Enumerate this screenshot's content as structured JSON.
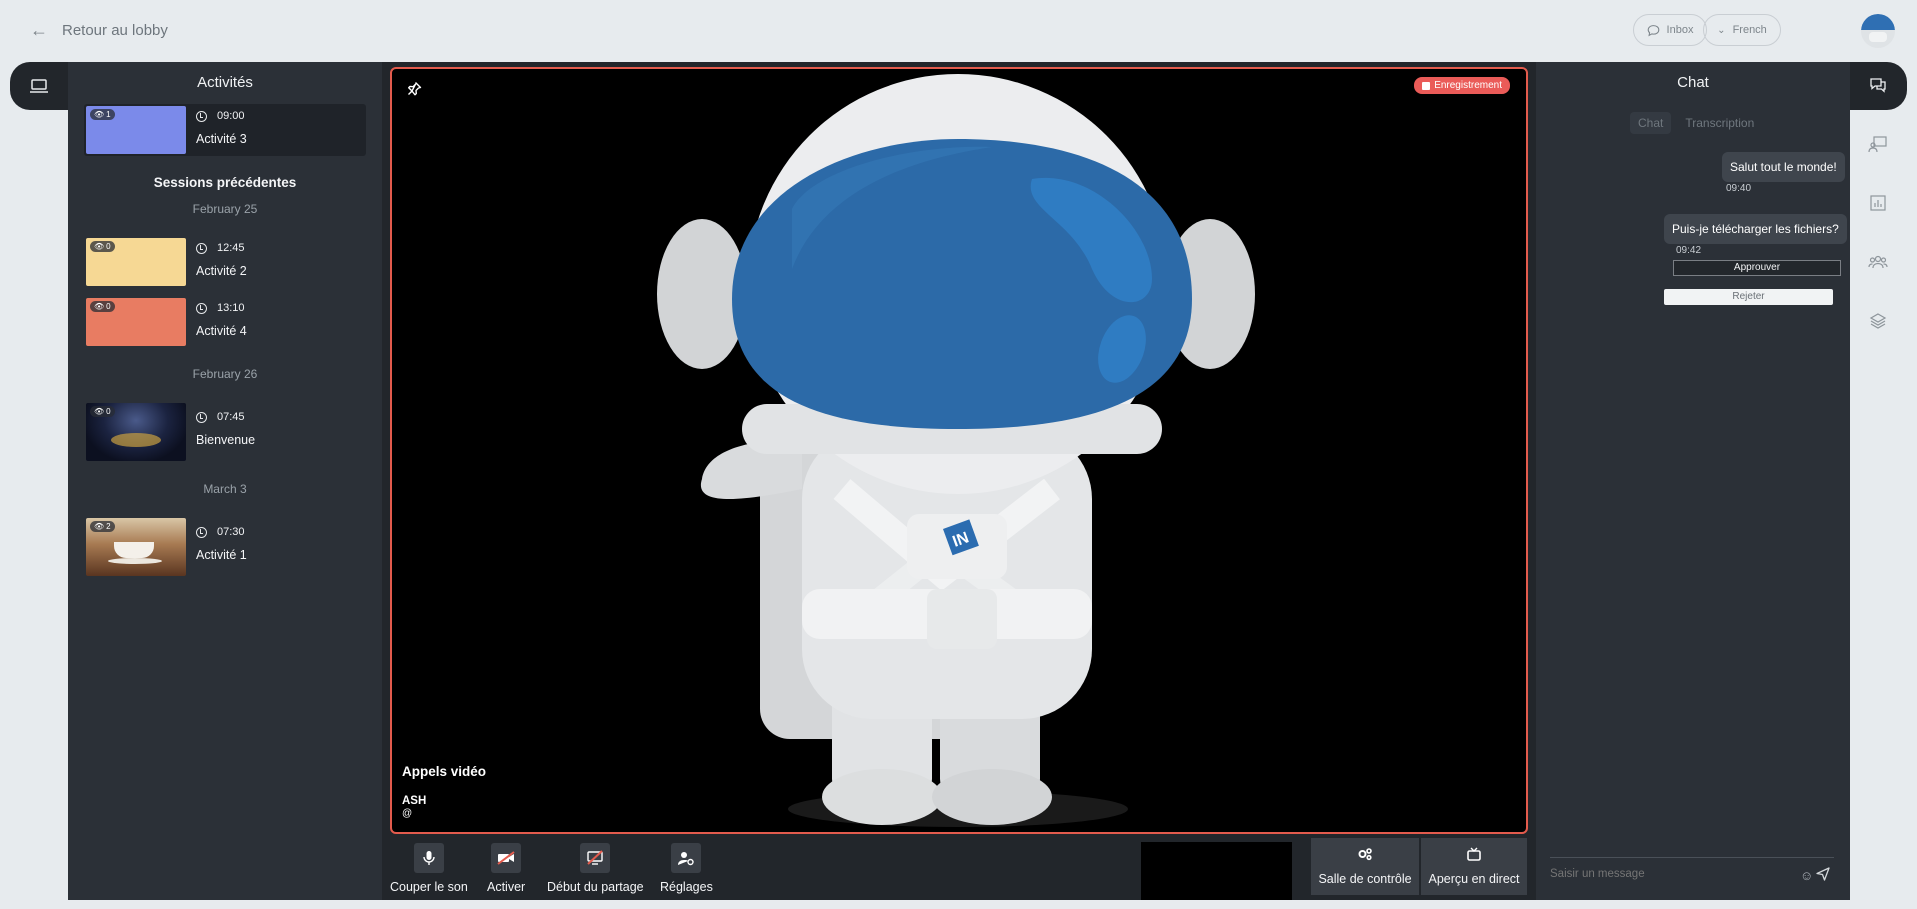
{
  "topbar": {
    "back_label": "Retour au lobby",
    "inbox_label": "Inbox",
    "language_label": "French"
  },
  "colors": {
    "accent_red": "#e35b4d",
    "recording_badge": "#ea5b58",
    "dark_panel": "#2b3037",
    "frame": "#22262b",
    "page_bg": "#e7ebee"
  },
  "left_rail": {
    "icons": [
      "laptop-icon",
      "coffee-cup-icon",
      "globe-icon",
      "people-icon"
    ]
  },
  "activities": {
    "title": "Activités",
    "current": {
      "viewers": "1",
      "time": "09:00",
      "name": "Activité 3",
      "thumb_color": "#7b8aea"
    },
    "previous_title": "Sessions précédentes",
    "groups": [
      {
        "date": "February 25",
        "items": [
          {
            "viewers": "0",
            "time": "12:45",
            "name": "Activité 2",
            "thumb_color": "#f6d894"
          },
          {
            "viewers": "0",
            "time": "13:10",
            "name": "Activité 4",
            "thumb_color": "#e87c62"
          }
        ]
      },
      {
        "date": "February 26",
        "items": [
          {
            "viewers": "0",
            "time": "07:45",
            "name": "Bienvenue",
            "thumb_color": "#1d2a4a"
          }
        ]
      },
      {
        "date": "March 3",
        "items": [
          {
            "viewers": "2",
            "time": "07:30",
            "name": "Activité 1",
            "thumb_color": "#8a5a3a"
          }
        ]
      }
    ]
  },
  "video": {
    "recording_label": "Enregistrement",
    "title": "Appels vidéo",
    "participant_name": "ASH",
    "participant_handle": "@"
  },
  "controls": {
    "mute_label": "Couper le son",
    "camera_label": "Activer",
    "share_label": "Début du partage",
    "settings_label": "Réglages",
    "control_room_label": "Salle de contrôle",
    "live_preview_label": "Aperçu en direct"
  },
  "chat": {
    "title": "Chat",
    "tabs": [
      "Chat",
      "Transcription"
    ],
    "messages": [
      {
        "text": "Salut tout le monde!",
        "time": "09:40"
      },
      {
        "text": "Puis-je télécharger les fichiers?",
        "time": "09:42"
      }
    ],
    "approve_label": "Approuver",
    "reject_label": "Rejeter",
    "input_placeholder": "Saisir un message"
  },
  "right_rail": {
    "icons": [
      "chat-icon",
      "presenter-icon",
      "chart-icon",
      "people-icon",
      "layers-icon"
    ]
  }
}
